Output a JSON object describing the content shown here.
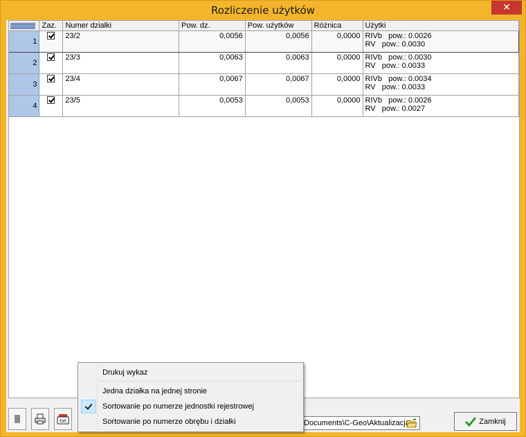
{
  "window": {
    "title": "Rozliczenie użytków",
    "close_glyph": "✕"
  },
  "table": {
    "headers": [
      "Zaz.",
      "Numer działki",
      "Pow. dz.",
      "Pow. użytków",
      "Różnica",
      "Użytki"
    ],
    "rows": [
      {
        "n": "1",
        "checked": true,
        "numer": "23/2",
        "pow_dz": "0,0056",
        "pow_uz": "0,0056",
        "roznica": "0,0000",
        "uzytki1": "RIVb   pow.: 0.0026",
        "uzytki2": "RV   pow.: 0.0030"
      },
      {
        "n": "2",
        "checked": true,
        "numer": "23/3",
        "pow_dz": "0,0063",
        "pow_uz": "0,0063",
        "roznica": "0,0000",
        "uzytki1": "RIVb   pow.: 0.0030",
        "uzytki2": "RV   pow.: 0.0033"
      },
      {
        "n": "3",
        "checked": true,
        "numer": "23/4",
        "pow_dz": "0,0067",
        "pow_uz": "0,0067",
        "roznica": "0,0000",
        "uzytki1": "RIVb   pow.: 0.0034",
        "uzytki2": "RV   pow.: 0.0033"
      },
      {
        "n": "4",
        "checked": true,
        "numer": "23/5",
        "pow_dz": "0,0053",
        "pow_uz": "0,0053",
        "roznica": "0,0000",
        "uzytki1": "RIVb   pow.: 0.0026",
        "uzytki2": "RV   pow.: 0.0027"
      }
    ]
  },
  "toolbar": {
    "icons": [
      "document-list-icon",
      "printer-icon",
      "txt-export-icon"
    ],
    "path_value": "Documents\\C-Geo\\Aktualizacja",
    "close_label": "Zamknij"
  },
  "context_menu": {
    "items": [
      {
        "label": "Drukuj wykaz",
        "checked": false
      },
      {
        "label": "Jedna działka na jednej stronie",
        "checked": false
      },
      {
        "label": "Sortowanie po numerze jednostki rejestrowej",
        "checked": true
      },
      {
        "label": "Sortowanie po numerze obrębu i działki",
        "checked": false
      }
    ]
  },
  "colors": {
    "title_bar": "#f3b52c",
    "close_button": "#c7372f",
    "row_header": "#aec6e8",
    "menu_highlight": "#cce8ff"
  }
}
